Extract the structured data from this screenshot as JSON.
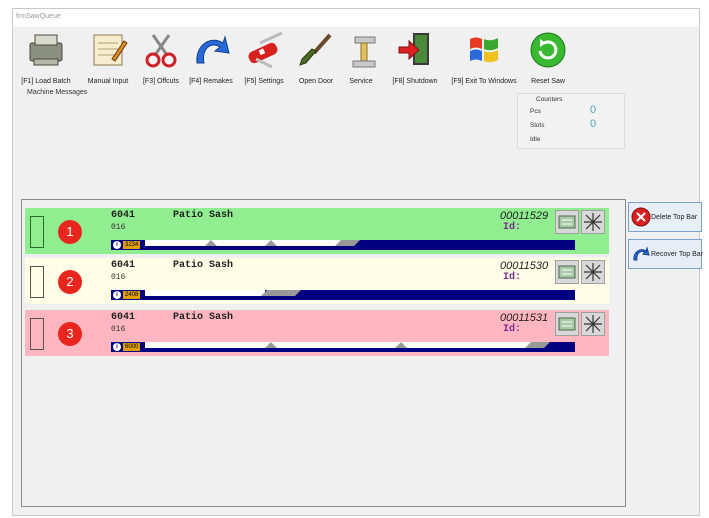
{
  "window": {
    "title": "frmSawQueue"
  },
  "toolbar": {
    "buttons": [
      {
        "label": "[F1] Load Batch",
        "icon": "printer-icon"
      },
      {
        "label": "Manual Input",
        "icon": "notepad-icon"
      },
      {
        "label": "[F3] Offcuts",
        "icon": "scissors-icon"
      },
      {
        "label": "[F4] Remakes",
        "icon": "redo-arrow-icon"
      },
      {
        "label": "[F5] Settings",
        "icon": "swiss-knife-icon"
      },
      {
        "label": "Open Door",
        "icon": "brush-icon"
      },
      {
        "label": "Service",
        "icon": "wrench-icon"
      },
      {
        "label": "[F8] Shutdown",
        "icon": "exit-door-icon"
      },
      {
        "label": "[F9] Exit To Windows",
        "icon": "windows-logo-icon"
      },
      {
        "label": "Reset Saw",
        "icon": "refresh-icon"
      }
    ]
  },
  "messages": {
    "label": "Machine Messages"
  },
  "counters": {
    "title": "Counters",
    "pcs_label": "Pcs",
    "pcs_value": "0",
    "slots_label": "Slots",
    "slots_value": "0",
    "idle_label": "Idle"
  },
  "queue": {
    "rows": [
      {
        "number": "1",
        "code": "6041",
        "sub": "016",
        "desc": "Patio Sash",
        "order": "00011529",
        "id_label": "Id:",
        "bar_length": "3234",
        "color": "#90ee90"
      },
      {
        "number": "2",
        "code": "6041",
        "sub": "016",
        "desc": "Patio Sash",
        "order": "00011530",
        "id_label": "Id:",
        "bar_length": "2408",
        "color": "#fffde6"
      },
      {
        "number": "3",
        "code": "6041",
        "sub": "016",
        "desc": "Patio Sash",
        "order": "00011531",
        "id_label": "Id:",
        "bar_length": "6000",
        "color": "#ffb6c1"
      }
    ]
  },
  "side": {
    "delete_label": "Delete Top Bar",
    "recover_label": "Recover Top Bar"
  },
  "colors": {
    "accent": "#000080",
    "badge": "#e8261e",
    "counter_value": "#4aa8b8"
  }
}
